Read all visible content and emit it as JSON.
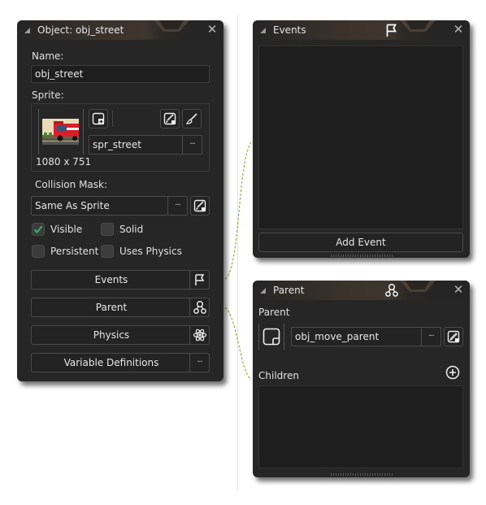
{
  "object_panel": {
    "title": "Object: obj_street",
    "name_label": "Name:",
    "name_value": "obj_street",
    "sprite_label": "Sprite:",
    "sprite_name": "spr_street",
    "sprite_size": "1080 x 751",
    "collision_label": "Collision Mask:",
    "collision_value": "Same As Sprite",
    "dots": "···",
    "checkboxes": [
      {
        "label": "Visible",
        "checked": true
      },
      {
        "label": "Solid",
        "checked": false
      },
      {
        "label": "Persistent",
        "checked": false
      },
      {
        "label": "Uses Physics",
        "checked": false
      }
    ],
    "buttons": [
      {
        "label": "Events",
        "icon": "flag-icon"
      },
      {
        "label": "Parent",
        "icon": "hierarchy-icon"
      },
      {
        "label": "Physics",
        "icon": "atom-gear-icon"
      },
      {
        "label": "Variable Definitions",
        "icon": "ellipsis-icon"
      }
    ]
  },
  "events_panel": {
    "title": "Events",
    "add_event_label": "Add Event"
  },
  "parent_panel": {
    "title": "Parent",
    "parent_label": "Parent",
    "parent_value": "obj_move_parent",
    "children_label": "Children"
  },
  "common": {
    "close": "✕"
  },
  "colors": {
    "panel_bg": "#262626",
    "connector": "#8dbb3c",
    "check": "#3cb371"
  }
}
